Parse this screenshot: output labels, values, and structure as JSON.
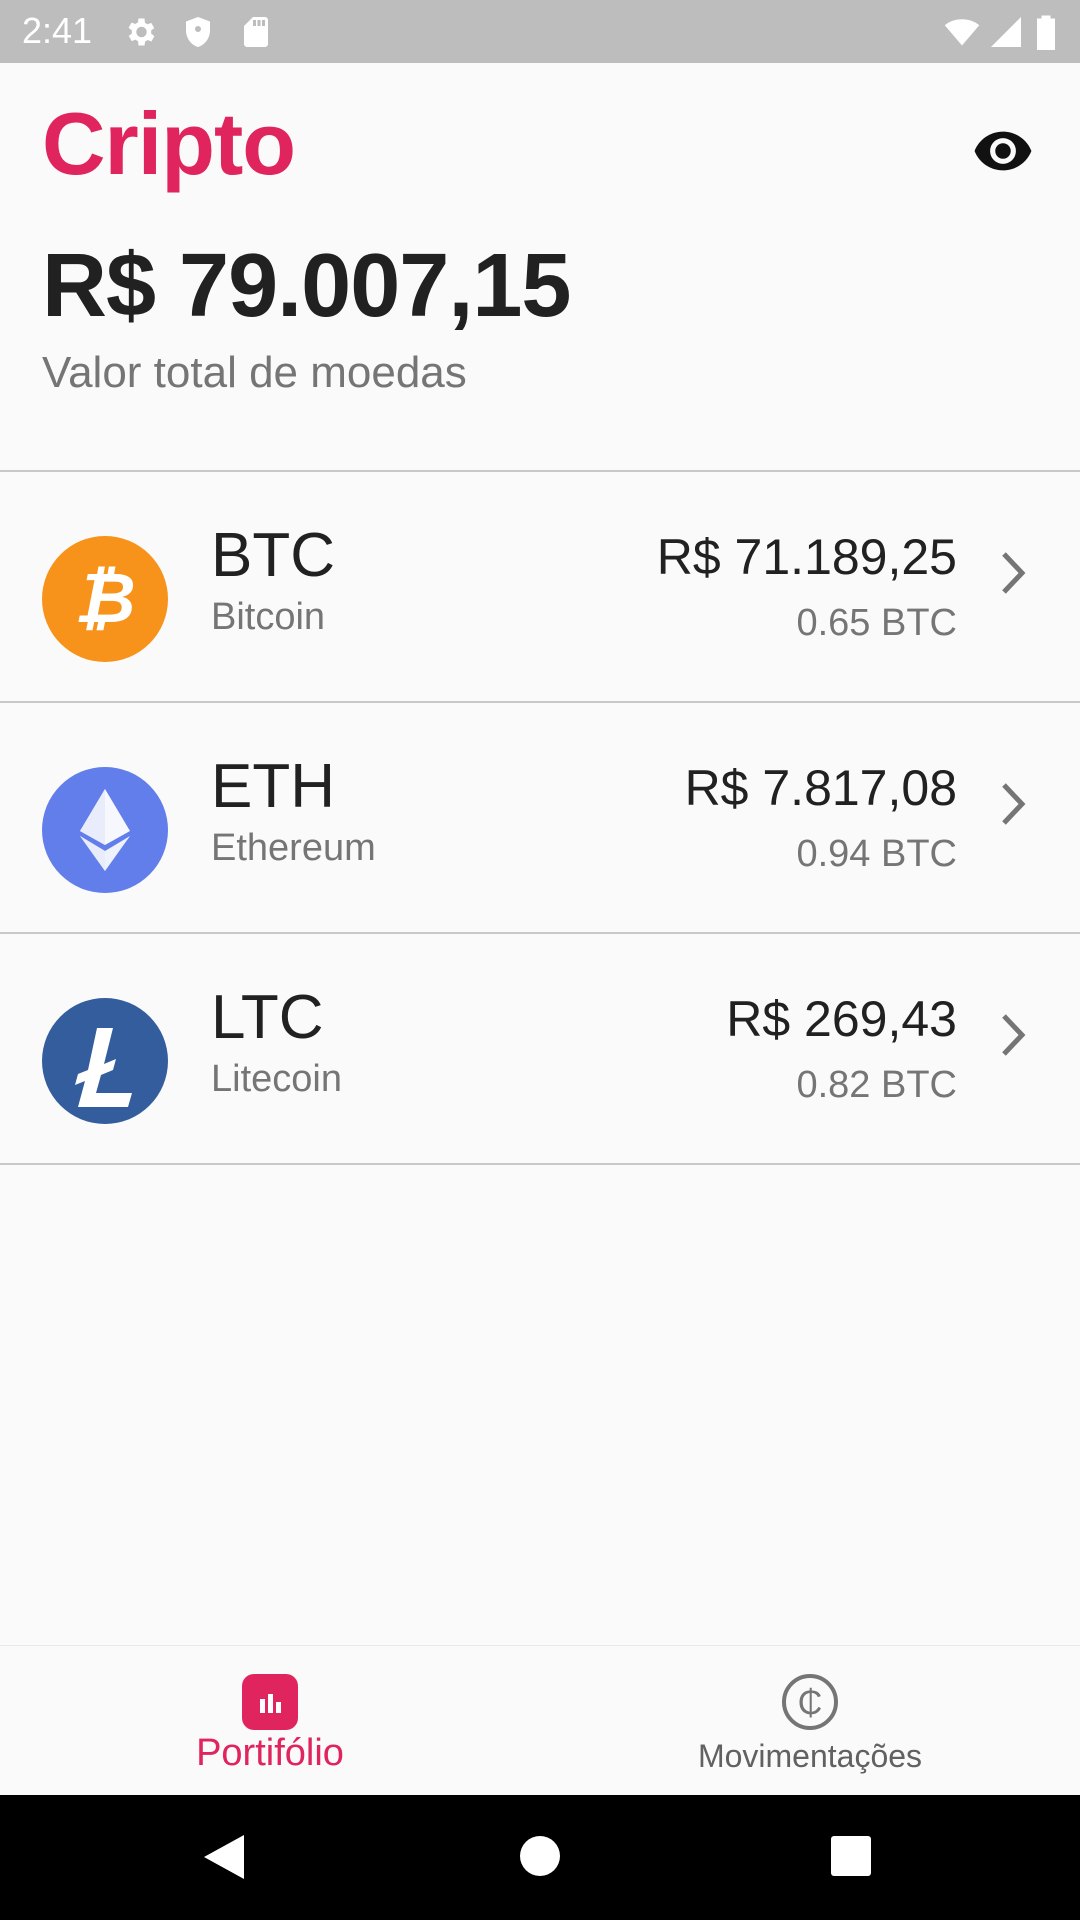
{
  "status_bar": {
    "time": "2:41",
    "icons_left": [
      "gear-icon",
      "shield-icon",
      "sd-card-icon"
    ],
    "icons_right": [
      "wifi-icon",
      "signal-icon",
      "battery-icon"
    ]
  },
  "header": {
    "title": "Cripto",
    "eye_icon": "eye-icon",
    "total_value": "R$ 79.007,15",
    "total_label": "Valor total de moedas"
  },
  "colors": {
    "accent": "#e0245e",
    "btc": "#f7931a",
    "eth": "#627eea",
    "ltc": "#345d9d"
  },
  "coins": [
    {
      "symbol": "BTC",
      "name": "Bitcoin",
      "value": "R$ 71.189,25",
      "amount": "0.65 BTC",
      "icon": "bitcoin-icon"
    },
    {
      "symbol": "ETH",
      "name": "Ethereum",
      "value": "R$ 7.817,08",
      "amount": "0.94 BTC",
      "icon": "ethereum-icon"
    },
    {
      "symbol": "LTC",
      "name": "Litecoin",
      "value": "R$ 269,43",
      "amount": "0.82 BTC",
      "icon": "litecoin-icon"
    }
  ],
  "bottom_nav": {
    "items": [
      {
        "label": "Portifólio",
        "icon": "chart-bars-icon",
        "active": true
      },
      {
        "label": "Movimentações",
        "icon": "coin-icon",
        "active": false
      }
    ]
  },
  "system_nav": [
    "back-icon",
    "home-icon",
    "recents-icon"
  ]
}
